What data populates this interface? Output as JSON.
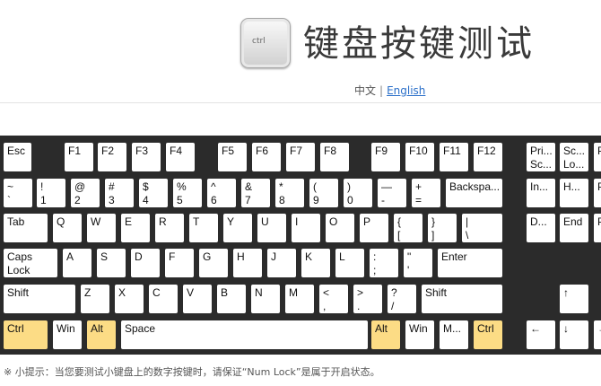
{
  "header": {
    "logo_key_label": "ctrl",
    "title": "键盘按键测试",
    "lang_cn": "中文",
    "lang_sep": "|",
    "lang_en": "English"
  },
  "keyboard": {
    "highlight_color": "#fcdc85",
    "rows": [
      [
        {
          "n": "esc",
          "l": [
            "Esc"
          ]
        },
        {
          "n": "f1",
          "l": [
            "F1"
          ]
        },
        {
          "n": "f2",
          "l": [
            "F2"
          ]
        },
        {
          "n": "f3",
          "l": [
            "F3"
          ]
        },
        {
          "n": "f4",
          "l": [
            "F4"
          ]
        },
        {
          "n": "f5",
          "l": [
            "F5"
          ]
        },
        {
          "n": "f6",
          "l": [
            "F6"
          ]
        },
        {
          "n": "f7",
          "l": [
            "F7"
          ]
        },
        {
          "n": "f8",
          "l": [
            "F8"
          ]
        },
        {
          "n": "f9",
          "l": [
            "F9"
          ]
        },
        {
          "n": "f10",
          "l": [
            "F10"
          ]
        },
        {
          "n": "f11",
          "l": [
            "F11"
          ]
        },
        {
          "n": "f12",
          "l": [
            "F12"
          ]
        },
        {
          "n": "print-screen",
          "l": [
            "Pri...",
            "Sc..."
          ]
        },
        {
          "n": "scroll-lock",
          "l": [
            "Sc...",
            "Lo..."
          ]
        },
        {
          "n": "pause",
          "l": [
            "P..."
          ]
        }
      ],
      [
        {
          "n": "tilde",
          "l": [
            "~",
            "`"
          ]
        },
        {
          "n": "1",
          "l": [
            "!",
            "1"
          ]
        },
        {
          "n": "2",
          "l": [
            "@",
            "2"
          ]
        },
        {
          "n": "3",
          "l": [
            "#",
            "3"
          ]
        },
        {
          "n": "4",
          "l": [
            "$",
            "4"
          ]
        },
        {
          "n": "5",
          "l": [
            "%",
            "5"
          ]
        },
        {
          "n": "6",
          "l": [
            "^",
            "6"
          ]
        },
        {
          "n": "7",
          "l": [
            "&",
            "7"
          ]
        },
        {
          "n": "8",
          "l": [
            "*",
            "8"
          ]
        },
        {
          "n": "9",
          "l": [
            "(",
            "9"
          ]
        },
        {
          "n": "0",
          "l": [
            ")",
            "0"
          ]
        },
        {
          "n": "minus",
          "l": [
            "—",
            "-"
          ]
        },
        {
          "n": "equals",
          "l": [
            "+",
            "="
          ]
        },
        {
          "n": "backspace",
          "l": [
            "Backspa..."
          ]
        },
        {
          "n": "insert",
          "l": [
            "In..."
          ]
        },
        {
          "n": "home",
          "l": [
            "H..."
          ]
        },
        {
          "n": "page-up",
          "l": [
            "P..."
          ]
        }
      ],
      [
        {
          "n": "tab",
          "l": [
            "Tab"
          ]
        },
        {
          "n": "q",
          "l": [
            "Q"
          ]
        },
        {
          "n": "w",
          "l": [
            "W"
          ]
        },
        {
          "n": "e",
          "l": [
            "E"
          ]
        },
        {
          "n": "r",
          "l": [
            "R"
          ]
        },
        {
          "n": "t",
          "l": [
            "T"
          ]
        },
        {
          "n": "y",
          "l": [
            "Y"
          ]
        },
        {
          "n": "u",
          "l": [
            "U"
          ]
        },
        {
          "n": "i",
          "l": [
            "I"
          ]
        },
        {
          "n": "o",
          "l": [
            "O"
          ]
        },
        {
          "n": "p",
          "l": [
            "P"
          ]
        },
        {
          "n": "open-bracket",
          "l": [
            "{",
            "["
          ]
        },
        {
          "n": "close-bracket",
          "l": [
            "}",
            "]"
          ]
        },
        {
          "n": "backslash",
          "l": [
            "|",
            "\\"
          ]
        },
        {
          "n": "delete",
          "l": [
            "D..."
          ]
        },
        {
          "n": "end",
          "l": [
            "End"
          ]
        },
        {
          "n": "page-down",
          "l": [
            "P..."
          ]
        }
      ],
      [
        {
          "n": "caps-lock",
          "l": [
            "Caps",
            "Lock"
          ]
        },
        {
          "n": "a",
          "l": [
            "A"
          ]
        },
        {
          "n": "s",
          "l": [
            "S"
          ]
        },
        {
          "n": "d",
          "l": [
            "D"
          ]
        },
        {
          "n": "f",
          "l": [
            "F"
          ]
        },
        {
          "n": "g",
          "l": [
            "G"
          ]
        },
        {
          "n": "h",
          "l": [
            "H"
          ]
        },
        {
          "n": "j",
          "l": [
            "J"
          ]
        },
        {
          "n": "k",
          "l": [
            "K"
          ]
        },
        {
          "n": "l",
          "l": [
            "L"
          ]
        },
        {
          "n": "semicolon",
          "l": [
            ":",
            ";"
          ]
        },
        {
          "n": "quote",
          "l": [
            "\"",
            "'"
          ]
        },
        {
          "n": "enter",
          "l": [
            "Enter"
          ]
        }
      ],
      [
        {
          "n": "left-shift",
          "l": [
            "Shift"
          ]
        },
        {
          "n": "z",
          "l": [
            "Z"
          ]
        },
        {
          "n": "x",
          "l": [
            "X"
          ]
        },
        {
          "n": "c",
          "l": [
            "C"
          ]
        },
        {
          "n": "v",
          "l": [
            "V"
          ]
        },
        {
          "n": "b",
          "l": [
            "B"
          ]
        },
        {
          "n": "n",
          "l": [
            "N"
          ]
        },
        {
          "n": "m",
          "l": [
            "M"
          ]
        },
        {
          "n": "comma",
          "l": [
            "<",
            ","
          ]
        },
        {
          "n": "period",
          "l": [
            ">",
            "."
          ]
        },
        {
          "n": "slash",
          "l": [
            "?",
            "/"
          ]
        },
        {
          "n": "right-shift",
          "l": [
            "Shift"
          ]
        },
        {
          "n": "arrow-up",
          "l": [
            "↑"
          ]
        }
      ],
      [
        {
          "n": "left-ctrl",
          "l": [
            "Ctrl"
          ],
          "on": true
        },
        {
          "n": "left-win",
          "l": [
            "Win"
          ]
        },
        {
          "n": "left-alt",
          "l": [
            "Alt"
          ],
          "on": true
        },
        {
          "n": "space",
          "l": [
            "Space"
          ]
        },
        {
          "n": "right-alt",
          "l": [
            "Alt"
          ],
          "on": true
        },
        {
          "n": "right-win",
          "l": [
            "Win"
          ]
        },
        {
          "n": "menu",
          "l": [
            "M..."
          ]
        },
        {
          "n": "right-ctrl",
          "l": [
            "Ctrl"
          ],
          "on": true
        },
        {
          "n": "arrow-left",
          "l": [
            "←"
          ]
        },
        {
          "n": "arrow-down",
          "l": [
            "↓"
          ]
        },
        {
          "n": "arrow-right",
          "l": [
            "→"
          ]
        }
      ]
    ]
  },
  "tip": "※ 小提示：当您要测试小键盘上的数字按键时，请保证“Num Lock”是属于开启状态。"
}
